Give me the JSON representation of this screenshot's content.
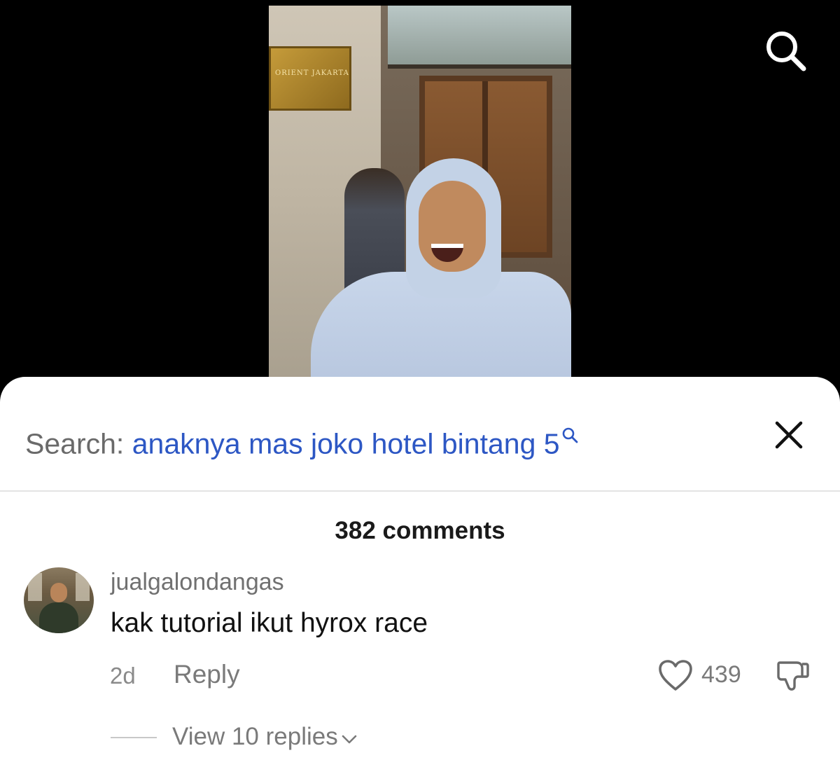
{
  "video": {
    "sign_text": "ORIENT JAKARTA"
  },
  "search": {
    "prefix": "Search:",
    "query": "anaknya mas joko hotel bintang 5"
  },
  "comments": {
    "count_label": "382 comments",
    "items": [
      {
        "username": "jualgalondangas",
        "text": "kak tutorial ikut hyrox race",
        "time": "2d",
        "reply_label": "Reply",
        "likes": "439",
        "view_replies_label": "View 10 replies"
      }
    ]
  },
  "colors": {
    "query_blue": "#2d57c4",
    "muted_gray": "#7a7a7a",
    "sheet_bg": "#ffffff",
    "backdrop": "#000000"
  },
  "icons": [
    "search-icon",
    "close-icon",
    "heart-icon",
    "dislike-icon",
    "chevron-down-icon"
  ]
}
